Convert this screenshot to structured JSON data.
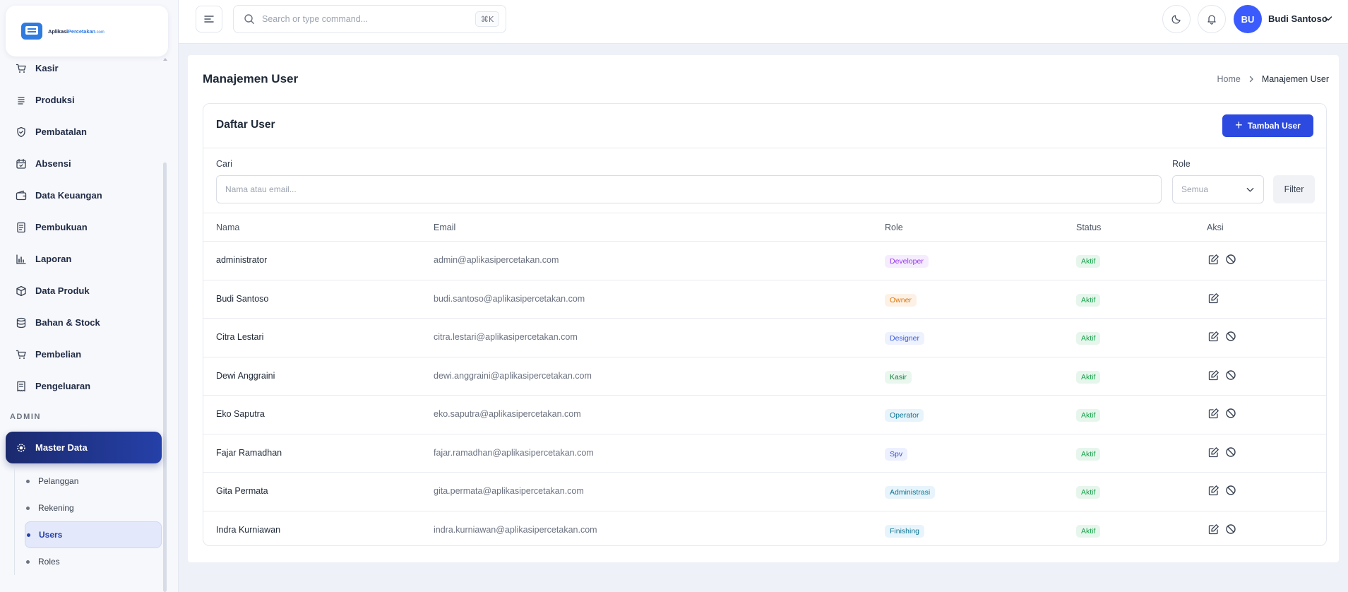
{
  "app": {
    "logo_text_main": "Aplikasi",
    "logo_text_accent": "Percetakan",
    "logo_text_suffix": ".com"
  },
  "sidebar": {
    "items": [
      {
        "label": "Kasir",
        "icon": "cart-icon",
        "has_chevron": true
      },
      {
        "label": "Produksi",
        "icon": "list-icon",
        "has_chevron": true
      },
      {
        "label": "Pembatalan",
        "icon": "shield-icon",
        "has_chevron": false
      },
      {
        "label": "Absensi",
        "icon": "calendar-check-icon",
        "has_chevron": true
      },
      {
        "label": "Data Keuangan",
        "icon": "wallet-icon",
        "has_chevron": true
      },
      {
        "label": "Pembukuan",
        "icon": "book-icon",
        "has_chevron": true
      },
      {
        "label": "Laporan",
        "icon": "bar-chart-icon",
        "has_chevron": true
      },
      {
        "label": "Data Produk",
        "icon": "box-icon",
        "has_chevron": true
      },
      {
        "label": "Bahan & Stock",
        "icon": "database-icon",
        "has_chevron": true
      },
      {
        "label": "Pembelian",
        "icon": "cart-icon",
        "has_chevron": false
      },
      {
        "label": "Pengeluaran",
        "icon": "receipt-icon",
        "has_chevron": true
      }
    ],
    "section_admin": "ADMIN",
    "master_data_label": "Master Data",
    "sub_items": [
      {
        "label": "Pelanggan",
        "active": false
      },
      {
        "label": "Rekening",
        "active": false
      },
      {
        "label": "Users",
        "active": true
      },
      {
        "label": "Roles",
        "active": false
      }
    ]
  },
  "topbar": {
    "search_placeholder": "Search or type command...",
    "search_shortcut": "⌘K",
    "avatar_initials": "BU",
    "user_name": "Budi Santoso"
  },
  "page": {
    "title": "Manajemen User",
    "breadcrumb_home": "Home",
    "breadcrumb_current": "Manajemen User"
  },
  "card": {
    "title": "Daftar User",
    "add_button": "Tambah User",
    "search_label": "Cari",
    "search_placeholder": "Nama atau email...",
    "role_label": "Role",
    "role_selected": "Semua",
    "filter_button": "Filter"
  },
  "table": {
    "headers": {
      "name": "Nama",
      "email": "Email",
      "role": "Role",
      "status": "Status",
      "actions": "Aksi"
    },
    "rows": [
      {
        "name": "administrator",
        "email": "admin@aplikasipercetakan.com",
        "role": "Developer",
        "status": "Aktif",
        "can_disable": true
      },
      {
        "name": "Budi Santoso",
        "email": "budi.santoso@aplikasipercetakan.com",
        "role": "Owner",
        "status": "Aktif",
        "can_disable": false
      },
      {
        "name": "Citra Lestari",
        "email": "citra.lestari@aplikasipercetakan.com",
        "role": "Designer",
        "status": "Aktif",
        "can_disable": true
      },
      {
        "name": "Dewi Anggraini",
        "email": "dewi.anggraini@aplikasipercetakan.com",
        "role": "Kasir",
        "status": "Aktif",
        "can_disable": true
      },
      {
        "name": "Eko Saputra",
        "email": "eko.saputra@aplikasipercetakan.com",
        "role": "Operator",
        "status": "Aktif",
        "can_disable": true
      },
      {
        "name": "Fajar Ramadhan",
        "email": "fajar.ramadhan@aplikasipercetakan.com",
        "role": "Spv",
        "status": "Aktif",
        "can_disable": true
      },
      {
        "name": "Gita Permata",
        "email": "gita.permata@aplikasipercetakan.com",
        "role": "Administrasi",
        "status": "Aktif",
        "can_disable": true
      },
      {
        "name": "Indra Kurniawan",
        "email": "indra.kurniawan@aplikasipercetakan.com",
        "role": "Finishing",
        "status": "Aktif",
        "can_disable": true
      }
    ]
  },
  "colors": {
    "primary": "#2d4ae0",
    "sidebar_active": "#1b2a6e",
    "role_badges": {
      "Developer": {
        "bg": "#f5ecfd",
        "fg": "#9333ea"
      },
      "Owner": {
        "bg": "#fdf1e6",
        "fg": "#d97706"
      },
      "Designer": {
        "bg": "#eef2fd",
        "fg": "#3b5bdb"
      },
      "Kasir": {
        "bg": "#e9f7ef",
        "fg": "#15803d"
      },
      "Operator": {
        "bg": "#e8f4fb",
        "fg": "#0e7490"
      },
      "Spv": {
        "bg": "#ecf0ff",
        "fg": "#3b4fc4"
      },
      "Administrasi": {
        "bg": "#e8f4fb",
        "fg": "#0e7490"
      },
      "Finishing": {
        "bg": "#e8f4fb",
        "fg": "#0e7490"
      }
    },
    "status_active": {
      "bg": "#e6f6ec",
      "fg": "#16a34a"
    }
  }
}
